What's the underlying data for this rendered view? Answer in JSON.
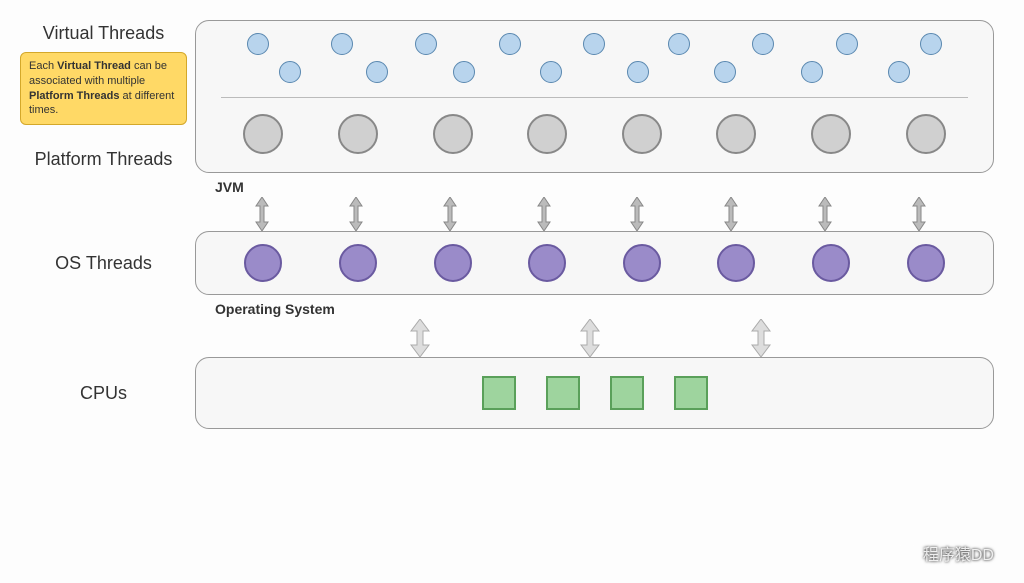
{
  "labels": {
    "virtual_threads": "Virtual Threads",
    "platform_threads": "Platform Threads",
    "os_threads": "OS Threads",
    "cpus": "CPUs",
    "jvm": "JVM",
    "operating_system": "Operating System"
  },
  "note": {
    "line1a": "Each ",
    "line1b": "Virtual Thread",
    "line1c": " can be associated with multiple ",
    "line2b": "Platform Threads",
    "line2c": " at different times."
  },
  "counts": {
    "virtual_threads_row1": 9,
    "virtual_threads_row2": 8,
    "platform_threads": 8,
    "os_threads": 8,
    "cpus": 4,
    "jvm_arrows": 8,
    "os_arrows": 3
  },
  "watermark": "程序猿DD",
  "colors": {
    "virtual_thread": "#b8d4ed",
    "platform_thread": "#d0d0d0",
    "os_thread": "#9a8bc9",
    "cpu": "#9ed49e",
    "note_bg": "#ffd966"
  }
}
